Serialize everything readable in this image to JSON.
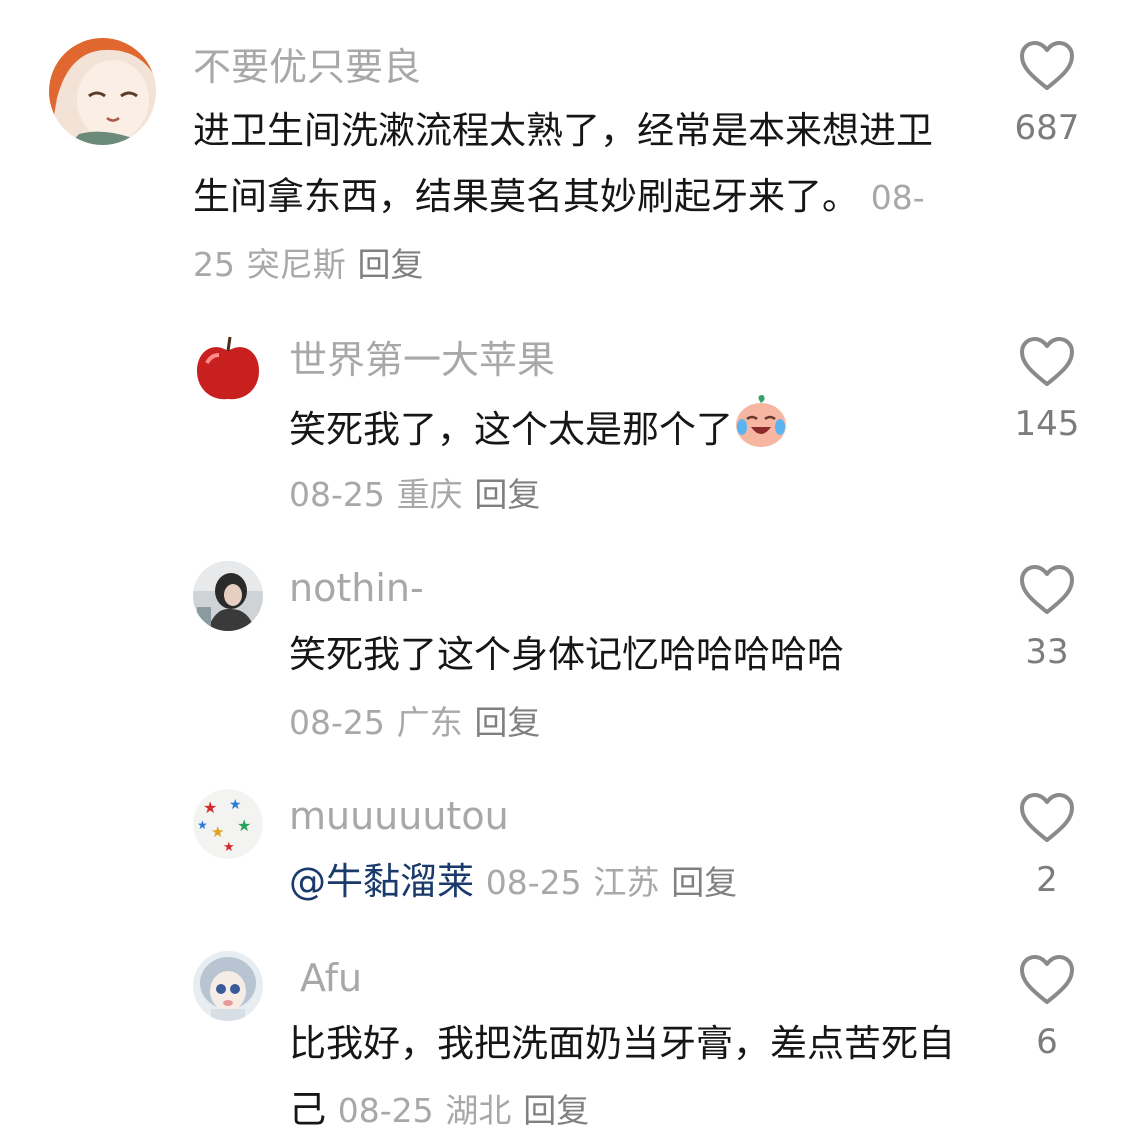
{
  "comments": [
    {
      "username": "不要优只要良",
      "text": "进卫生间洗漱流程太熟了，经常是本来想进卫生间拿东西，结果莫名其妙刷起牙来了。",
      "date": "08-25",
      "location": "突尼斯",
      "reply_label": "回复",
      "likes": "687",
      "avatar_icon": "anime-girl-avatar"
    },
    {
      "username": "世界第一大苹果",
      "text": "笑死我了，这个太是那个了",
      "emoji": "laughing-crying-peach-emoji",
      "date": "08-25",
      "location": "重庆",
      "reply_label": "回复",
      "likes": "145",
      "avatar_icon": "red-apple-avatar"
    },
    {
      "username": "nothin-",
      "text": "笑死我了这个身体记忆哈哈哈哈哈",
      "date": "08-25",
      "location": "广东",
      "reply_label": "回复",
      "likes": "33",
      "avatar_icon": "person-photo-avatar"
    },
    {
      "username": "muuuuutou",
      "mention": "@牛黏溜莱",
      "date": "08-25",
      "location": "江苏",
      "reply_label": "回复",
      "likes": "2",
      "avatar_icon": "star-ball-avatar"
    },
    {
      "username": "Afu",
      "text": "比我好，我把洗面奶当牙膏，差点苦死自己",
      "date": "08-25",
      "location": "湖北",
      "reply_label": "回复",
      "likes": "6",
      "avatar_icon": "doll-avatar"
    }
  ],
  "colors": {
    "username": "#a8a8a8",
    "text": "#161616",
    "mention": "#1a3a6b",
    "like_icon": "#8a8a8a"
  }
}
